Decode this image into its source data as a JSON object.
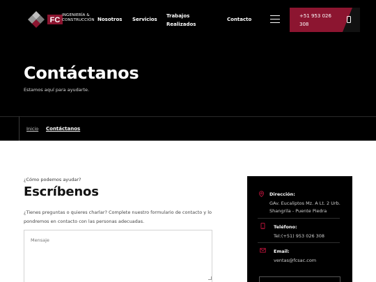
{
  "brand": {
    "logo_letters": "FC",
    "name_line1": "INGENIERÍA &",
    "name_line2": "CONSTRUCCIÓN",
    "accent_color": "#8c1530"
  },
  "nav": {
    "items": [
      {
        "label": "Nosotros"
      },
      {
        "label": "Servicios"
      },
      {
        "label": "Trabajos Realizados"
      },
      {
        "label": "Contacto"
      }
    ],
    "menu_icon": "hamburger-icon",
    "phone_label": "+51 953 026 308",
    "phone_icon": "mobile-phone-icon"
  },
  "hero": {
    "title": "Contáctanos",
    "subtitle": "Estamos aquí para ayudarte."
  },
  "breadcrumb": {
    "home": "Inicio",
    "current": "Contáctanos"
  },
  "form_section": {
    "eyebrow": "¿Cómo podemos ayudar?",
    "title": "Escríbenos",
    "description": "¿Tienes preguntas o quieres charlar? Complete nuestro formulario de contacto y lo pondremos en contacto con las personas adecuadas.",
    "message_placeholder": "Mensaje"
  },
  "contact_card": {
    "address": {
      "label": "Dirección:",
      "value": "GAv. Eucaliptos Mz. A Lt. 2 Urb. Shangrila - Puente Piedra",
      "icon": "location-pin-icon"
    },
    "phone": {
      "label": "Teléfono:",
      "value": "Tel:(+51) 953 026 308",
      "icon": "mobile-phone-icon"
    },
    "email": {
      "label": "Email:",
      "value": "ventas@fcsac.com",
      "icon": "envelope-icon"
    },
    "icon_color": "#c0143c"
  }
}
